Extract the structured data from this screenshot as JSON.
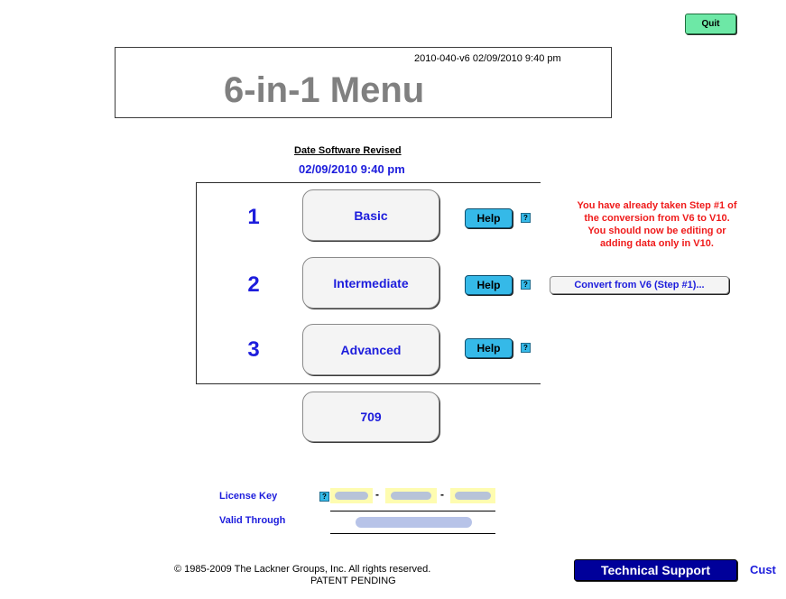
{
  "header": {
    "quit_label": "Quit",
    "build_stamp": "2010-040-v6 02/09/2010 9:40 pm",
    "title": "6-in-1 Menu"
  },
  "revision": {
    "label": "Date Software Revised",
    "date": "02/09/2010 9:40 pm"
  },
  "menu": {
    "items": [
      {
        "number": "1",
        "label": "Basic",
        "help_label": "Help",
        "q_label": "?"
      },
      {
        "number": "2",
        "label": "Intermediate",
        "help_label": "Help",
        "q_label": "?"
      },
      {
        "number": "3",
        "label": "Advanced",
        "help_label": "Help",
        "q_label": "?"
      }
    ],
    "extra_button_label": "709"
  },
  "conversion": {
    "message_lines": [
      "You have already taken Step #1 of",
      "the conversion from V6 to V10.",
      "You should now be editing or",
      "adding data only in V10."
    ],
    "button_label": "Convert from V6 (Step #1)..."
  },
  "license": {
    "key_label": "License Key",
    "q_label": "?",
    "dash": "-",
    "valid_label": "Valid Through"
  },
  "footer": {
    "copyright": "© 1985-2009 The Lackner Groups, Inc.  All rights reserved.",
    "patent": "PATENT PENDING",
    "tech_support_label": "Technical Support",
    "cust_label": "Cust"
  },
  "colors": {
    "accent_blue": "#1d1ddc",
    "warning_red": "#ef1b1b",
    "help_cyan": "#35b9e8",
    "quit_green": "#6de8a6",
    "support_navy": "#00009a"
  }
}
